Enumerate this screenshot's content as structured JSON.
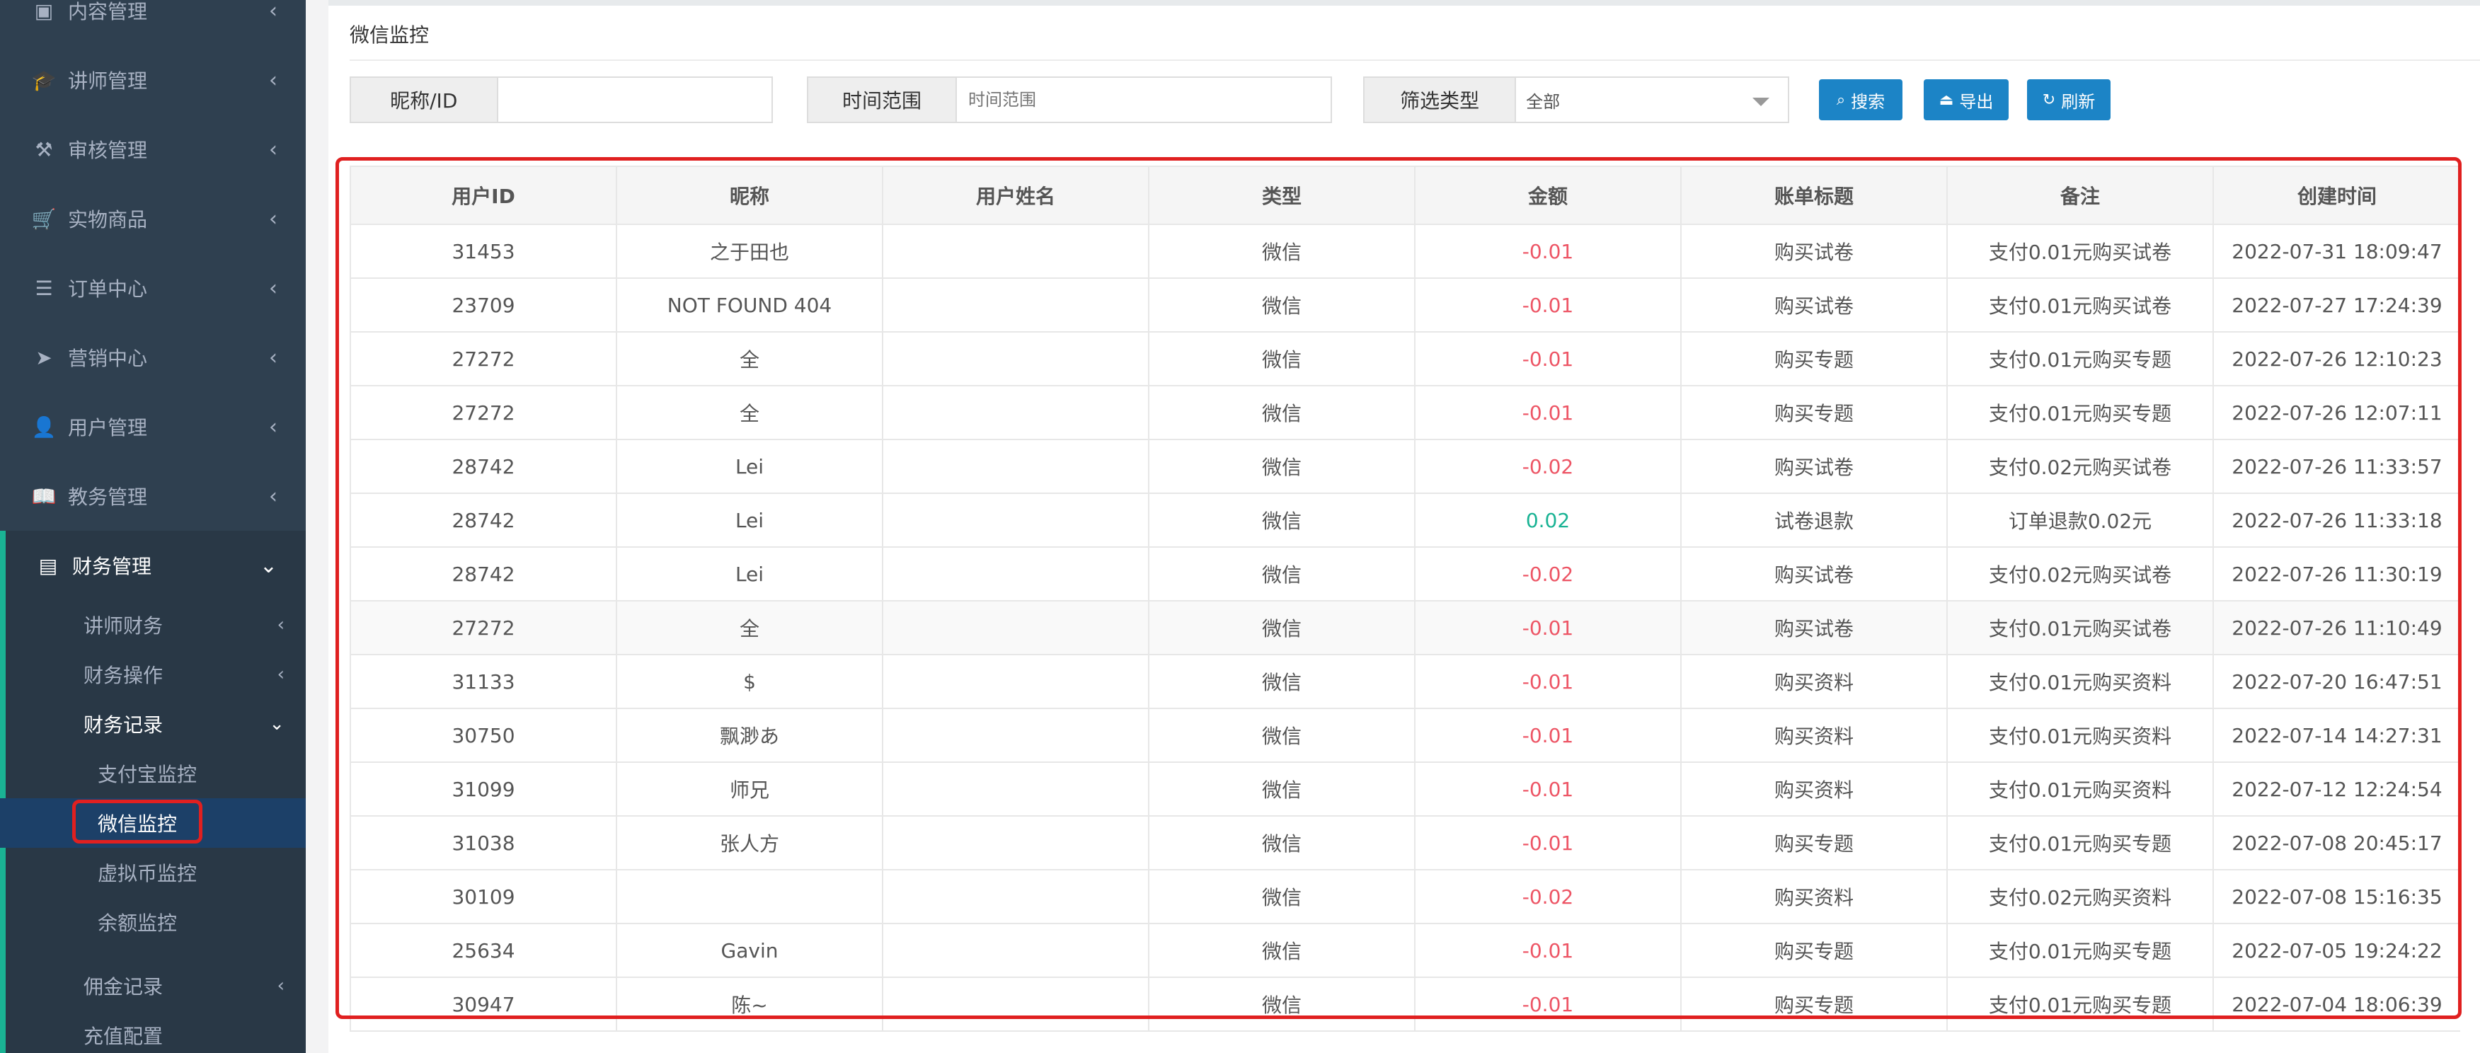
{
  "sidebar": {
    "menu": [
      {
        "label": "内容管理",
        "icon": "content-icon",
        "glyph": "▣"
      },
      {
        "label": "讲师管理",
        "icon": "graduation-cap-icon",
        "glyph": "🎓"
      },
      {
        "label": "审核管理",
        "icon": "gavel-icon",
        "glyph": "⚒"
      },
      {
        "label": "实物商品",
        "icon": "cart-icon",
        "glyph": "🛒"
      },
      {
        "label": "订单中心",
        "icon": "list-icon",
        "glyph": "☰"
      },
      {
        "label": "营销中心",
        "icon": "paper-plane-icon",
        "glyph": "➤"
      },
      {
        "label": "用户管理",
        "icon": "user-icon",
        "glyph": "👤"
      },
      {
        "label": "教务管理",
        "icon": "book-icon",
        "glyph": "📖"
      }
    ],
    "open_menu": {
      "label": "财务管理",
      "icon": "money-icon",
      "glyph": "▤"
    },
    "sub": [
      {
        "label": "讲师财务"
      },
      {
        "label": "财务操作"
      },
      {
        "label": "财务记录"
      }
    ],
    "sub3": [
      {
        "label": "支付宝监控"
      },
      {
        "label": "微信监控"
      },
      {
        "label": "虚拟币监控"
      },
      {
        "label": "余额监控"
      }
    ],
    "sub_more": [
      {
        "label": "佣金记录"
      },
      {
        "label": "充值配置"
      }
    ]
  },
  "page": {
    "title": "微信监控"
  },
  "filters": {
    "nickname_label": "昵称/ID",
    "nickname_value": "",
    "time_label": "时间范围",
    "time_placeholder": "时间范围",
    "type_label": "筛选类型",
    "type_selected": "全部"
  },
  "buttons": {
    "search": "搜索",
    "export": "导出",
    "refresh": "刷新"
  },
  "colors": {
    "sidebar_bg": "#2f4050",
    "primary_button": "#1c84c6",
    "negative_amount": "#ed5565",
    "positive_amount": "#1ab394",
    "highlight_outline": "#e02020"
  },
  "table": {
    "headers": [
      "用户ID",
      "昵称",
      "用户姓名",
      "类型",
      "金额",
      "账单标题",
      "备注",
      "创建时间"
    ],
    "rows": [
      [
        "31453",
        "之于田也",
        "",
        "微信",
        "-0.01",
        "购买试卷",
        "支付0.01元购买试卷",
        "2022-07-31 18:09:47"
      ],
      [
        "23709",
        "NOT FOUND 404",
        "",
        "微信",
        "-0.01",
        "购买试卷",
        "支付0.01元购买试卷",
        "2022-07-27 17:24:39"
      ],
      [
        "27272",
        "全",
        "",
        "微信",
        "-0.01",
        "购买专题",
        "支付0.01元购买专题",
        "2022-07-26 12:10:23"
      ],
      [
        "27272",
        "全",
        "",
        "微信",
        "-0.01",
        "购买专题",
        "支付0.01元购买专题",
        "2022-07-26 12:07:11"
      ],
      [
        "28742",
        "Lei",
        "",
        "微信",
        "-0.02",
        "购买试卷",
        "支付0.02元购买试卷",
        "2022-07-26 11:33:57"
      ],
      [
        "28742",
        "Lei",
        "",
        "微信",
        "0.02",
        "试卷退款",
        "订单退款0.02元",
        "2022-07-26 11:33:18"
      ],
      [
        "28742",
        "Lei",
        "",
        "微信",
        "-0.02",
        "购买试卷",
        "支付0.02元购买试卷",
        "2022-07-26 11:30:19"
      ],
      [
        "27272",
        "全",
        "",
        "微信",
        "-0.01",
        "购买试卷",
        "支付0.01元购买试卷",
        "2022-07-26 11:10:49"
      ],
      [
        "31133",
        "$",
        "",
        "微信",
        "-0.01",
        "购买资料",
        "支付0.01元购买资料",
        "2022-07-20 16:47:51"
      ],
      [
        "30750",
        "飘渺あ",
        "",
        "微信",
        "-0.01",
        "购买资料",
        "支付0.01元购买资料",
        "2022-07-14 14:27:31"
      ],
      [
        "31099",
        "师兄",
        "",
        "微信",
        "-0.01",
        "购买资料",
        "支付0.01元购买资料",
        "2022-07-12 12:24:54"
      ],
      [
        "31038",
        "张人方",
        "",
        "微信",
        "-0.01",
        "购买专题",
        "支付0.01元购买专题",
        "2022-07-08 20:45:17"
      ],
      [
        "30109",
        "",
        "",
        "微信",
        "-0.02",
        "购买资料",
        "支付0.02元购买资料",
        "2022-07-08 15:16:35"
      ],
      [
        "25634",
        "Gavin",
        "",
        "微信",
        "-0.01",
        "购买专题",
        "支付0.01元购买专题",
        "2022-07-05 19:24:22"
      ],
      [
        "30947",
        "陈~",
        "",
        "微信",
        "-0.01",
        "购买专题",
        "支付0.01元购买专题",
        "2022-07-04 18:06:39"
      ]
    ]
  }
}
